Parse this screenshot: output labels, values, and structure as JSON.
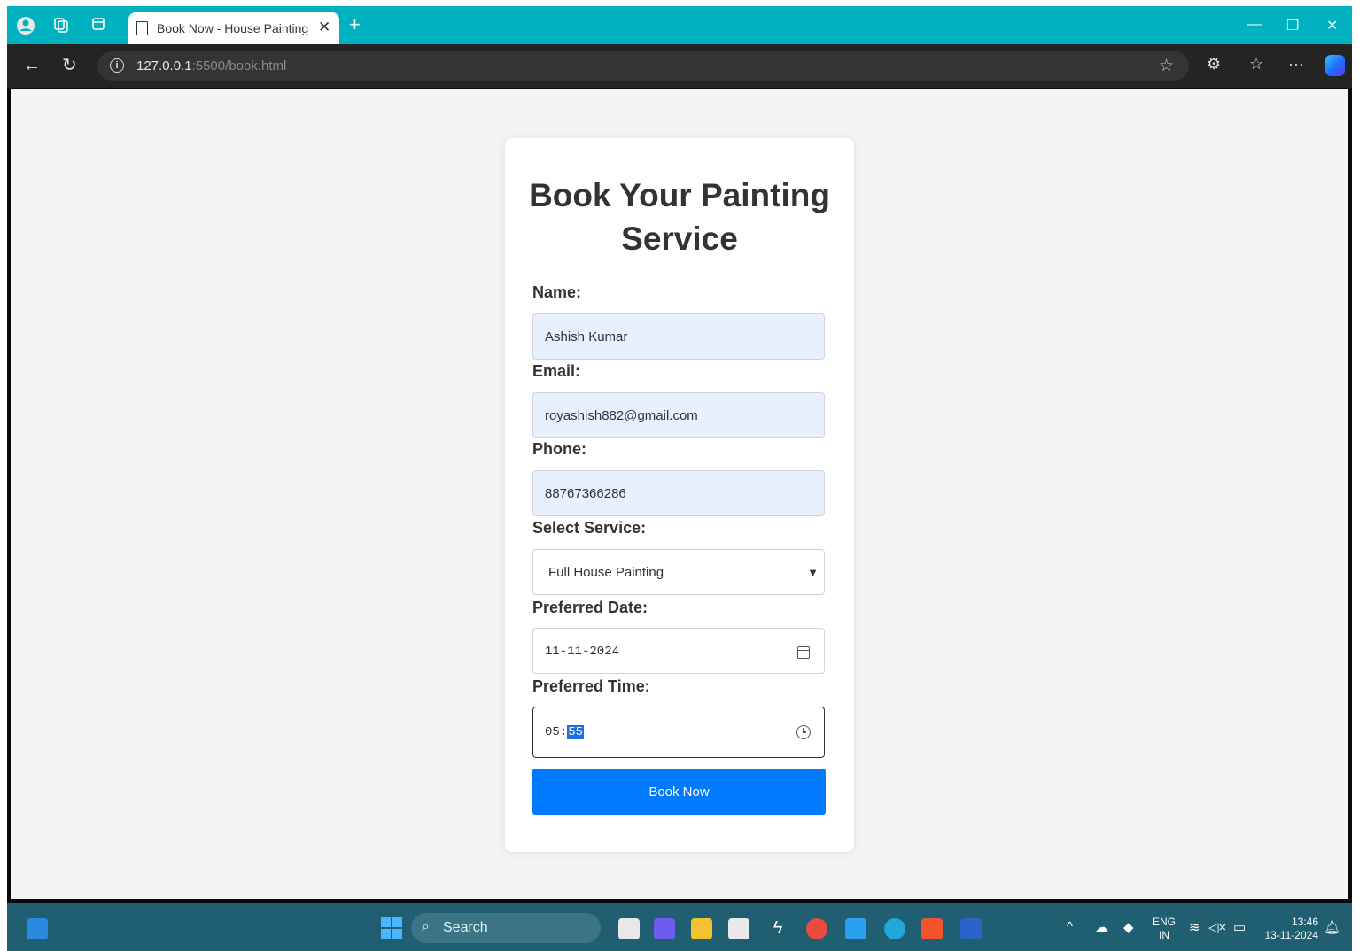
{
  "browser": {
    "tab_title": "Book Now - House Painting Serv",
    "url_host": "127.0.0.1",
    "url_rest": ":5500/book.html"
  },
  "form": {
    "title": "Book Your Painting Service",
    "name_label": "Name:",
    "name_value": "Ashish Kumar",
    "email_label": "Email:",
    "email_value": "royashish882@gmail.com",
    "phone_label": "Phone:",
    "phone_value": "88767366286",
    "service_label": "Select Service:",
    "service_value": "Full House Painting",
    "date_label": "Preferred Date:",
    "date_value": "11-11-2024",
    "time_label": "Preferred Time:",
    "time_hour": "05",
    "time_minute": "55",
    "submit_label": "Book Now"
  },
  "taskbar": {
    "search_label": "Search",
    "lang_top": "ENG",
    "lang_bottom": "IN",
    "time": "13:46",
    "date": "13-11-2024"
  },
  "colors": {
    "tabbar": "#00b2bf",
    "primary_button": "#007bff",
    "autofill_bg": "#e8f0fe",
    "taskbar": "#1f5f71"
  }
}
